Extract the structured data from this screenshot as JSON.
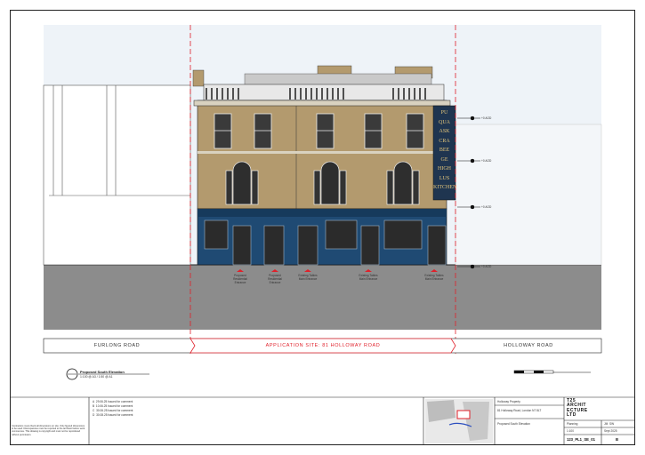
{
  "roads": {
    "left": "FURLONG ROAD",
    "site": "APPLICATION SITE: 81 HOLLOWAY ROAD",
    "right": "HOLLOWAY ROAD"
  },
  "drawing_title": {
    "title": "Proposed South Elevation",
    "scale": "1:100 @ A3 / 1:50 @ A1"
  },
  "levels": [
    "+0 AOD",
    "+0 AOD",
    "+0 AOD",
    "+0 AOD"
  ],
  "entrances": [
    {
      "line1": "Proposed",
      "line2": "Residential",
      "line3": "Entrance"
    },
    {
      "line1": "Proposed",
      "line2": "Residential",
      "line3": "Entrance"
    },
    {
      "line1": "Existing Tables",
      "line2": "Main Entrance",
      "line3": ""
    },
    {
      "line1": "Existing Tables",
      "line2": "Main Entrance",
      "line3": ""
    },
    {
      "line1": "Existing Tables",
      "line2": "Main Entrance",
      "line3": ""
    }
  ],
  "sign_text": [
    "PU",
    "QUA",
    "ASK",
    "CRA",
    "BEE",
    "GE",
    "HIGH",
    "LUS",
    "KITCHEN"
  ],
  "revisions": [
    {
      "rev": "A",
      "date": "29.06.25",
      "desc": "Issued for comment"
    },
    {
      "rev": "B",
      "date": "10.06.25",
      "desc": "Issued for comment"
    },
    {
      "rev": "C",
      "date": "30.06.25",
      "desc": "Issued for comment"
    },
    {
      "rev": "D",
      "date": "30.08.25",
      "desc": "Issued for comment"
    }
  ],
  "notes": "Contractors must check all dimensions on site. Only figured dimensions to be used. Discrepancies must be reported to the architect before work commences. This drawing is copyright and must not be reproduced without permission.",
  "title_block": {
    "client": "Holloway Property",
    "project": "81 Holloway Road, London N7 8LT",
    "drawing": "Proposed South Elevation",
    "firm_line1": "T25",
    "firm_line2": "ARCHIT",
    "firm_line3": "ECTURE",
    "firm_line4": "LTD",
    "status": "Planning",
    "drawn": "JM",
    "checked": "SW",
    "scale": "1:100",
    "date": "Sept 2025",
    "number": "123_PL1_SE_01",
    "revision": "B"
  },
  "colors": {
    "brick": "#b39a6e",
    "shopfront": "#1f4a73",
    "sign": "#1f3550",
    "site_boundary": "#e0202a",
    "ground": "#8c8c8c",
    "sky": "#eef3f8"
  }
}
